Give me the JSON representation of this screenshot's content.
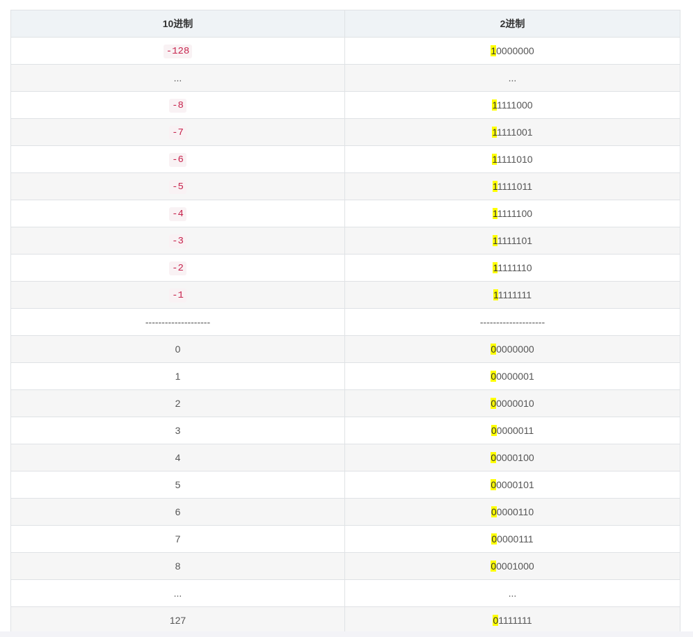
{
  "table": {
    "headers": [
      "10进制",
      "2进制"
    ],
    "rows": [
      {
        "dec": "-128",
        "dec_code": true,
        "bin_first": "1",
        "bin_rest": "0000000"
      },
      {
        "dec": "...",
        "dec_code": false,
        "bin_first": "",
        "bin_rest": "..."
      },
      {
        "dec": "-8",
        "dec_code": true,
        "bin_first": "1",
        "bin_rest": "1111000"
      },
      {
        "dec": "-7",
        "dec_code": true,
        "bin_first": "1",
        "bin_rest": "1111001"
      },
      {
        "dec": "-6",
        "dec_code": true,
        "bin_first": "1",
        "bin_rest": "1111010"
      },
      {
        "dec": "-5",
        "dec_code": true,
        "bin_first": "1",
        "bin_rest": "1111011"
      },
      {
        "dec": "-4",
        "dec_code": true,
        "bin_first": "1",
        "bin_rest": "1111100"
      },
      {
        "dec": "-3",
        "dec_code": true,
        "bin_first": "1",
        "bin_rest": "1111101"
      },
      {
        "dec": "-2",
        "dec_code": true,
        "bin_first": "1",
        "bin_rest": "1111110"
      },
      {
        "dec": "-1",
        "dec_code": true,
        "bin_first": "1",
        "bin_rest": "1111111"
      },
      {
        "dec": "--------------------",
        "dec_code": false,
        "bin_first": "",
        "bin_rest": "--------------------"
      },
      {
        "dec": "0",
        "dec_code": false,
        "bin_first": "0",
        "bin_rest": "0000000"
      },
      {
        "dec": "1",
        "dec_code": false,
        "bin_first": "0",
        "bin_rest": "0000001"
      },
      {
        "dec": "2",
        "dec_code": false,
        "bin_first": "0",
        "bin_rest": "0000010"
      },
      {
        "dec": "3",
        "dec_code": false,
        "bin_first": "0",
        "bin_rest": "0000011"
      },
      {
        "dec": "4",
        "dec_code": false,
        "bin_first": "0",
        "bin_rest": "0000100"
      },
      {
        "dec": "5",
        "dec_code": false,
        "bin_first": "0",
        "bin_rest": "0000101"
      },
      {
        "dec": "6",
        "dec_code": false,
        "bin_first": "0",
        "bin_rest": "0000110"
      },
      {
        "dec": "7",
        "dec_code": false,
        "bin_first": "0",
        "bin_rest": "0000111"
      },
      {
        "dec": "8",
        "dec_code": false,
        "bin_first": "0",
        "bin_rest": "0001000"
      },
      {
        "dec": "...",
        "dec_code": false,
        "bin_first": "",
        "bin_rest": "..."
      },
      {
        "dec": "127",
        "dec_code": false,
        "bin_first": "0",
        "bin_rest": "1111111"
      }
    ]
  },
  "colors": {
    "header_bg": "#eff3f6",
    "stripe_bg": "#f6f6f6",
    "code_text": "#c7254e",
    "highlight": "#ffff00"
  }
}
